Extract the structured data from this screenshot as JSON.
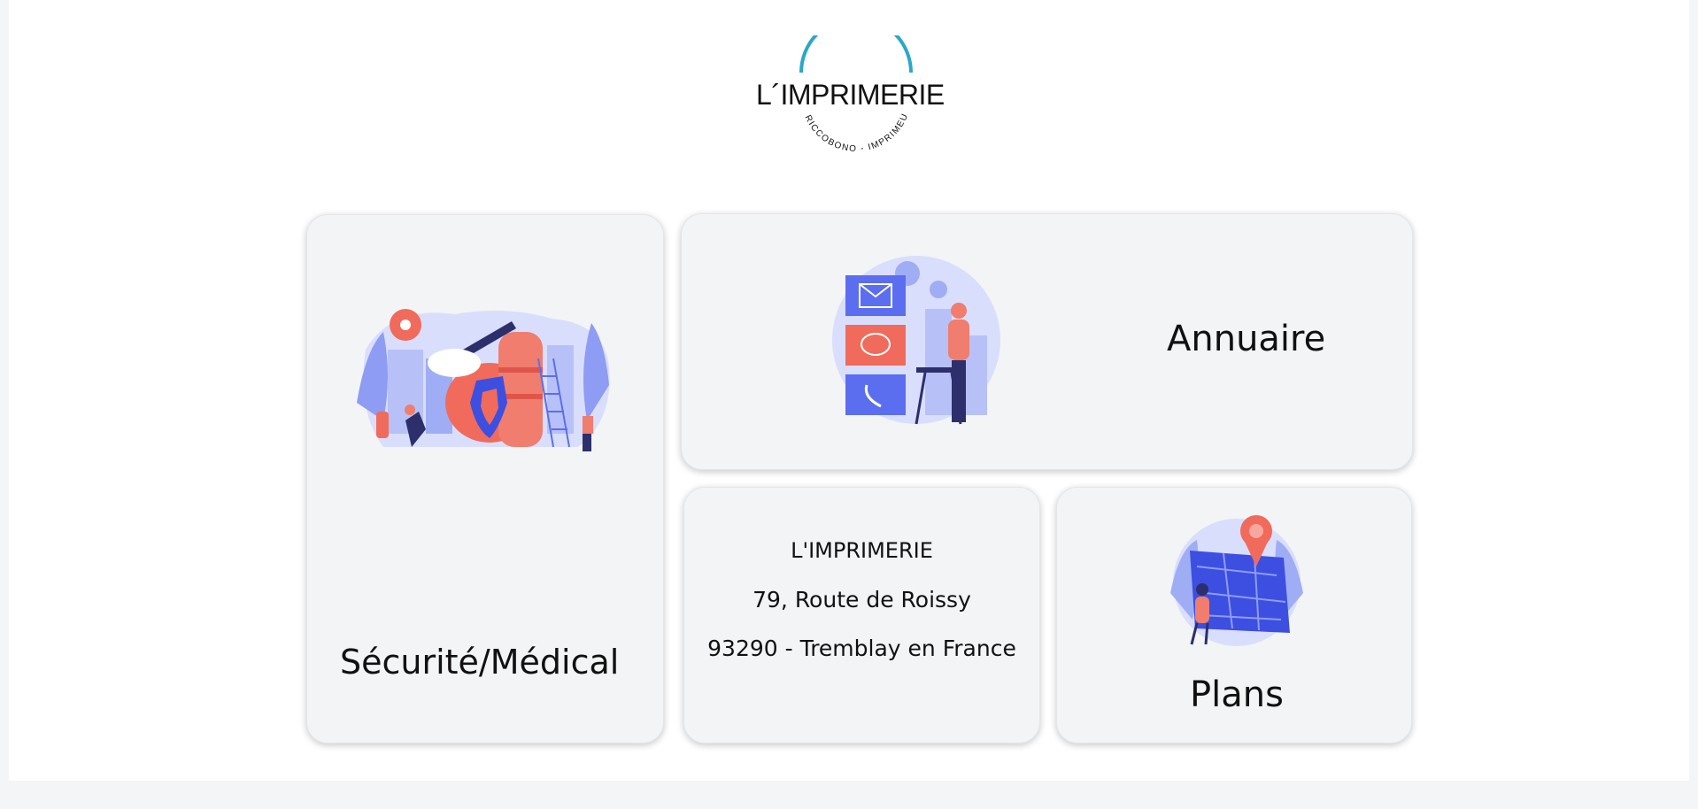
{
  "logo": {
    "wordmark": "L´IMPRIMERIE",
    "tagline": "RICCOBONO - IMPRIMEURS",
    "arc_color": "#2aa7c9"
  },
  "cards": {
    "securite": {
      "title": "Sécurité/Médical"
    },
    "annuaire": {
      "title": "Annuaire"
    },
    "adresse": {
      "company": "L'IMPRIMERIE",
      "street": "79, Route de Roissy",
      "city": "93290 - Tremblay en France"
    },
    "plans": {
      "title": "Plans"
    }
  },
  "colors": {
    "accent_blue": "#5b6ef0",
    "accent_red": "#f06b5b",
    "card_bg": "#f2f4f6"
  }
}
